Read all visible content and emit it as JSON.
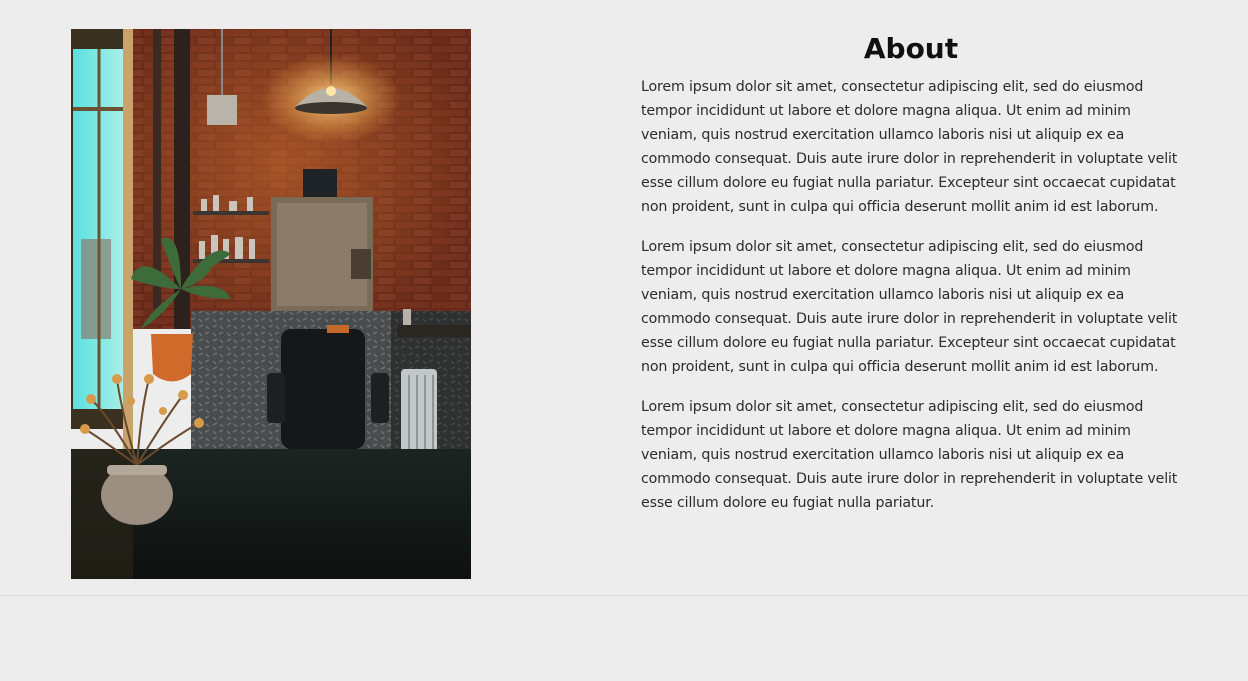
{
  "about": {
    "title": "About",
    "paragraphs": [
      "Lorem ipsum dolor sit amet, consectetur adipiscing elit, sed do eiusmod tempor incididunt ut labore et dolore magna aliqua. Ut enim ad minim veniam, quis nostrud exercitation ullamco laboris nisi ut aliquip ex ea commodo consequat. Duis aute irure dolor in reprehenderit in voluptate velit esse cillum dolore eu fugiat nulla pariatur. Excepteur sint occaecat cupidatat non proident, sunt in culpa qui officia deserunt mollit anim id est laborum.",
      "Lorem ipsum dolor sit amet, consectetur adipiscing elit, sed do eiusmod tempor incididunt ut labore et dolore magna aliqua. Ut enim ad minim veniam, quis nostrud exercitation ullamco laboris nisi ut aliquip ex ea commodo consequat. Duis aute irure dolor in reprehenderit in voluptate velit esse cillum dolore eu fugiat nulla pariatur. Excepteur sint occaecat cupidatat non proident, sunt in culpa qui officia deserunt mollit anim id est laborum.",
      "Lorem ipsum dolor sit amet, consectetur adipiscing elit, sed do eiusmod tempor incididunt ut labore et dolore magna aliqua. Ut enim ad minim veniam, quis nostrud exercitation ullamco laboris nisi ut aliquip ex ea commodo consequat. Duis aute irure dolor in reprehenderit in voluptate velit esse cillum dolore eu fugiat nulla pariatur."
    ]
  },
  "colors": {
    "page_background": "#ededed",
    "heading": "#111111",
    "body_text": "#2b2b2b",
    "divider": "#d8d8d8"
  }
}
